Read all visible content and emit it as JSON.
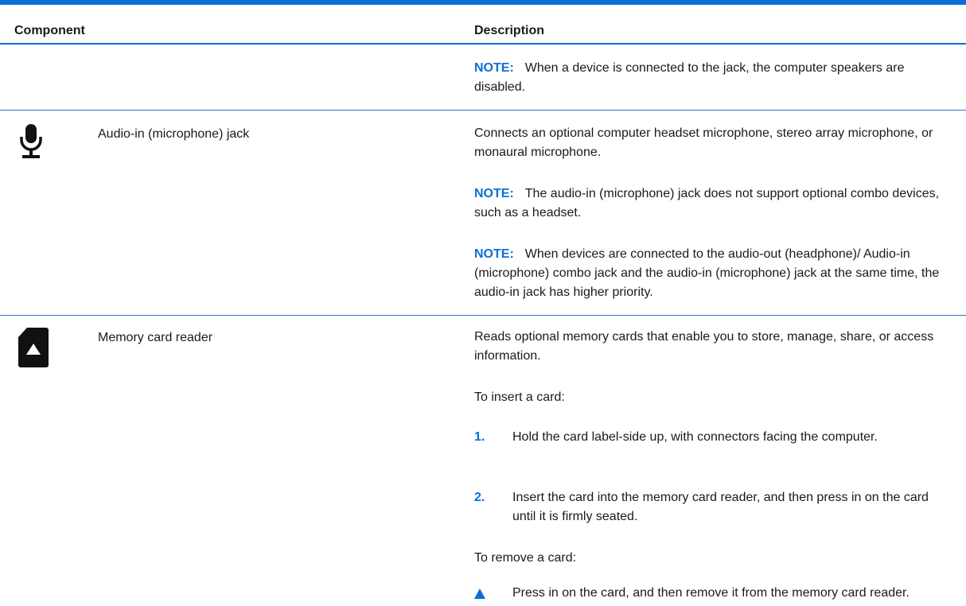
{
  "header": {
    "component": "Component",
    "description": "Description"
  },
  "note_label": "NOTE:",
  "row_continued": {
    "note": "When a device is connected to the jack, the computer speakers are disabled."
  },
  "row_mic": {
    "icon": "microphone-icon",
    "name": "Audio-in (microphone) jack",
    "desc": "Connects an optional computer headset microphone, stereo array microphone, or monaural microphone.",
    "note1": "The audio-in (microphone) jack does not support optional combo devices, such as a headset.",
    "note2": "When devices are connected to the audio-out (headphone)/ Audio-in (microphone) combo jack and the audio-in (microphone) jack at the same time, the audio-in jack has higher priority."
  },
  "row_card": {
    "icon": "memory-card-icon",
    "name": "Memory card reader",
    "desc": "Reads optional memory cards that enable you to store, manage, share, or access information.",
    "insert_heading": "To insert a card:",
    "step1_num": "1.",
    "step1": "Hold the card label-side up, with connectors facing the computer.",
    "step2_num": "2.",
    "step2": "Insert the card into the memory card reader, and then press in on the card until it is firmly seated.",
    "remove_heading": "To remove a card:",
    "remove_step": "Press in on the card, and then remove it from the memory card reader."
  },
  "colors": {
    "accent": "#0a6fd6"
  }
}
